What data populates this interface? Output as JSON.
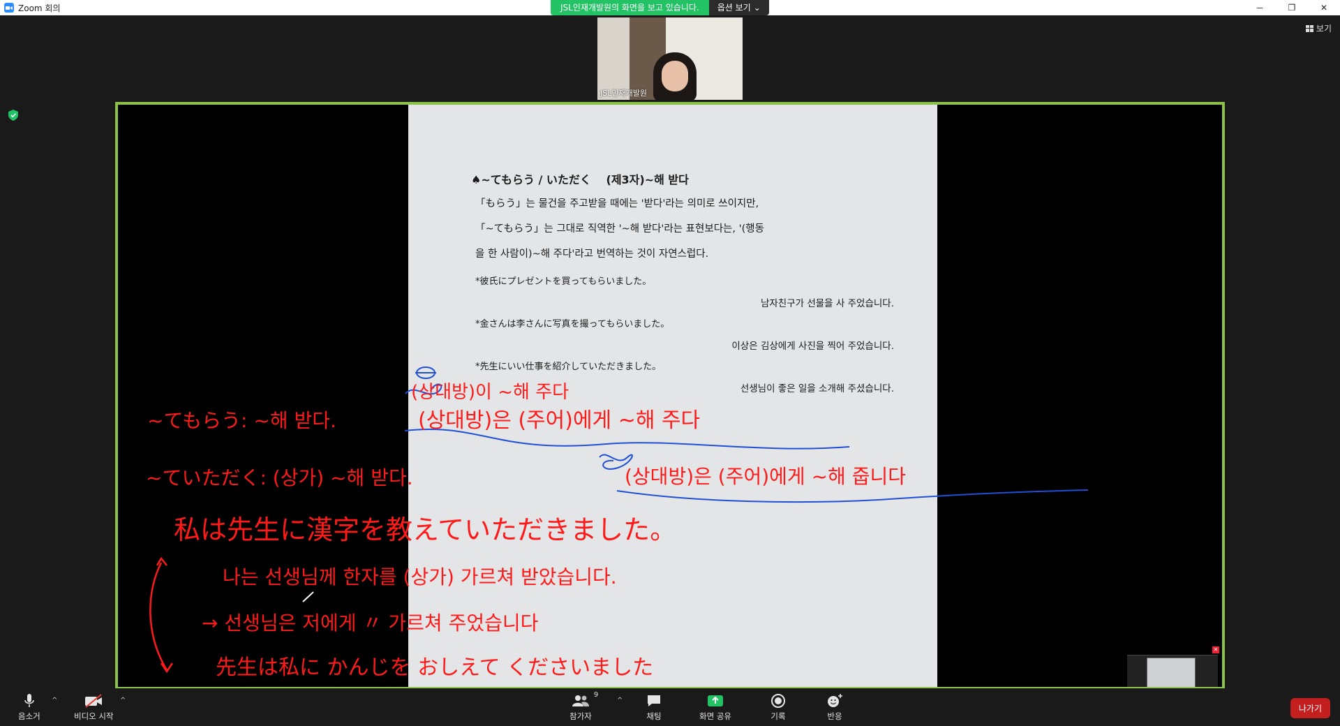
{
  "titlebar": {
    "app_title": "Zoom 회의",
    "icon": "zoom-logo-icon"
  },
  "share_banner": {
    "message": "JSL인재개발원의 화면을 보고 있습니다.",
    "options_label": "옵션 보기"
  },
  "view_button": {
    "label": "보기"
  },
  "participant_thumb": {
    "name": "JSL인재개발원"
  },
  "document": {
    "heading": "♠~てもらう / いただく　 (제3자)~해 받다",
    "paragraph": [
      "「もらう」는 물건을 주고받을 때에는 '받다'라는 의미로 쓰이지만,",
      "「~てもらう」는 그대로 직역한 '~해 받다'라는 표현보다는, '(행동",
      "을 한 사람이)~해 주다'라고 번역하는 것이 자연스럽다."
    ],
    "examples": [
      {
        "jp": "*彼氏にプレゼントを買ってもらいました。",
        "ko": "남자친구가 선물을 사 주었습니다."
      },
      {
        "jp": "*金さんは李さんに写真を撮ってもらいました。",
        "ko": "이상은 김상에게 사진을 찍어 주었습니다."
      },
      {
        "jp": "*先生にいい仕事を紹介していただきました。",
        "ko": "선생님이 좋은 일을 소개해 주셨습니다."
      }
    ]
  },
  "annotations": {
    "line1_left": "~てもらう: ~해 받다.",
    "line1_right": "(상대방)은 (주어)에게 ~해 주다",
    "line0": "(상대방)이 ~해 주다",
    "line2_left": "~ていただく: (상가) ~해 받다.",
    "line2_right": "(상대방)은 (주어)에게 ~해 줍니다",
    "line3": "私は先生に漢字を教えていただきました。",
    "line4": "나는 선생님께 한자를 (상가) 가르쳐 받았습니다.",
    "line5": "→ 선생님은 저에게 〃 가르쳐 주었습니다",
    "line6": "先生は私に かんじを おしえて くださいました"
  },
  "toolbar": {
    "mute_label": "음소거",
    "video_label": "비디오 시작",
    "participants_label": "참가자",
    "participants_count": "9",
    "chat_label": "채팅",
    "share_label": "화면 공유",
    "record_label": "기록",
    "reactions_label": "반응",
    "leave_label": "나가기"
  },
  "colors": {
    "share_border": "#8bc34a",
    "banner_green": "#23c265",
    "ink_red": "#ff1a1a",
    "ink_blue": "#1f4fd6",
    "leave_red": "#c41f1f"
  }
}
